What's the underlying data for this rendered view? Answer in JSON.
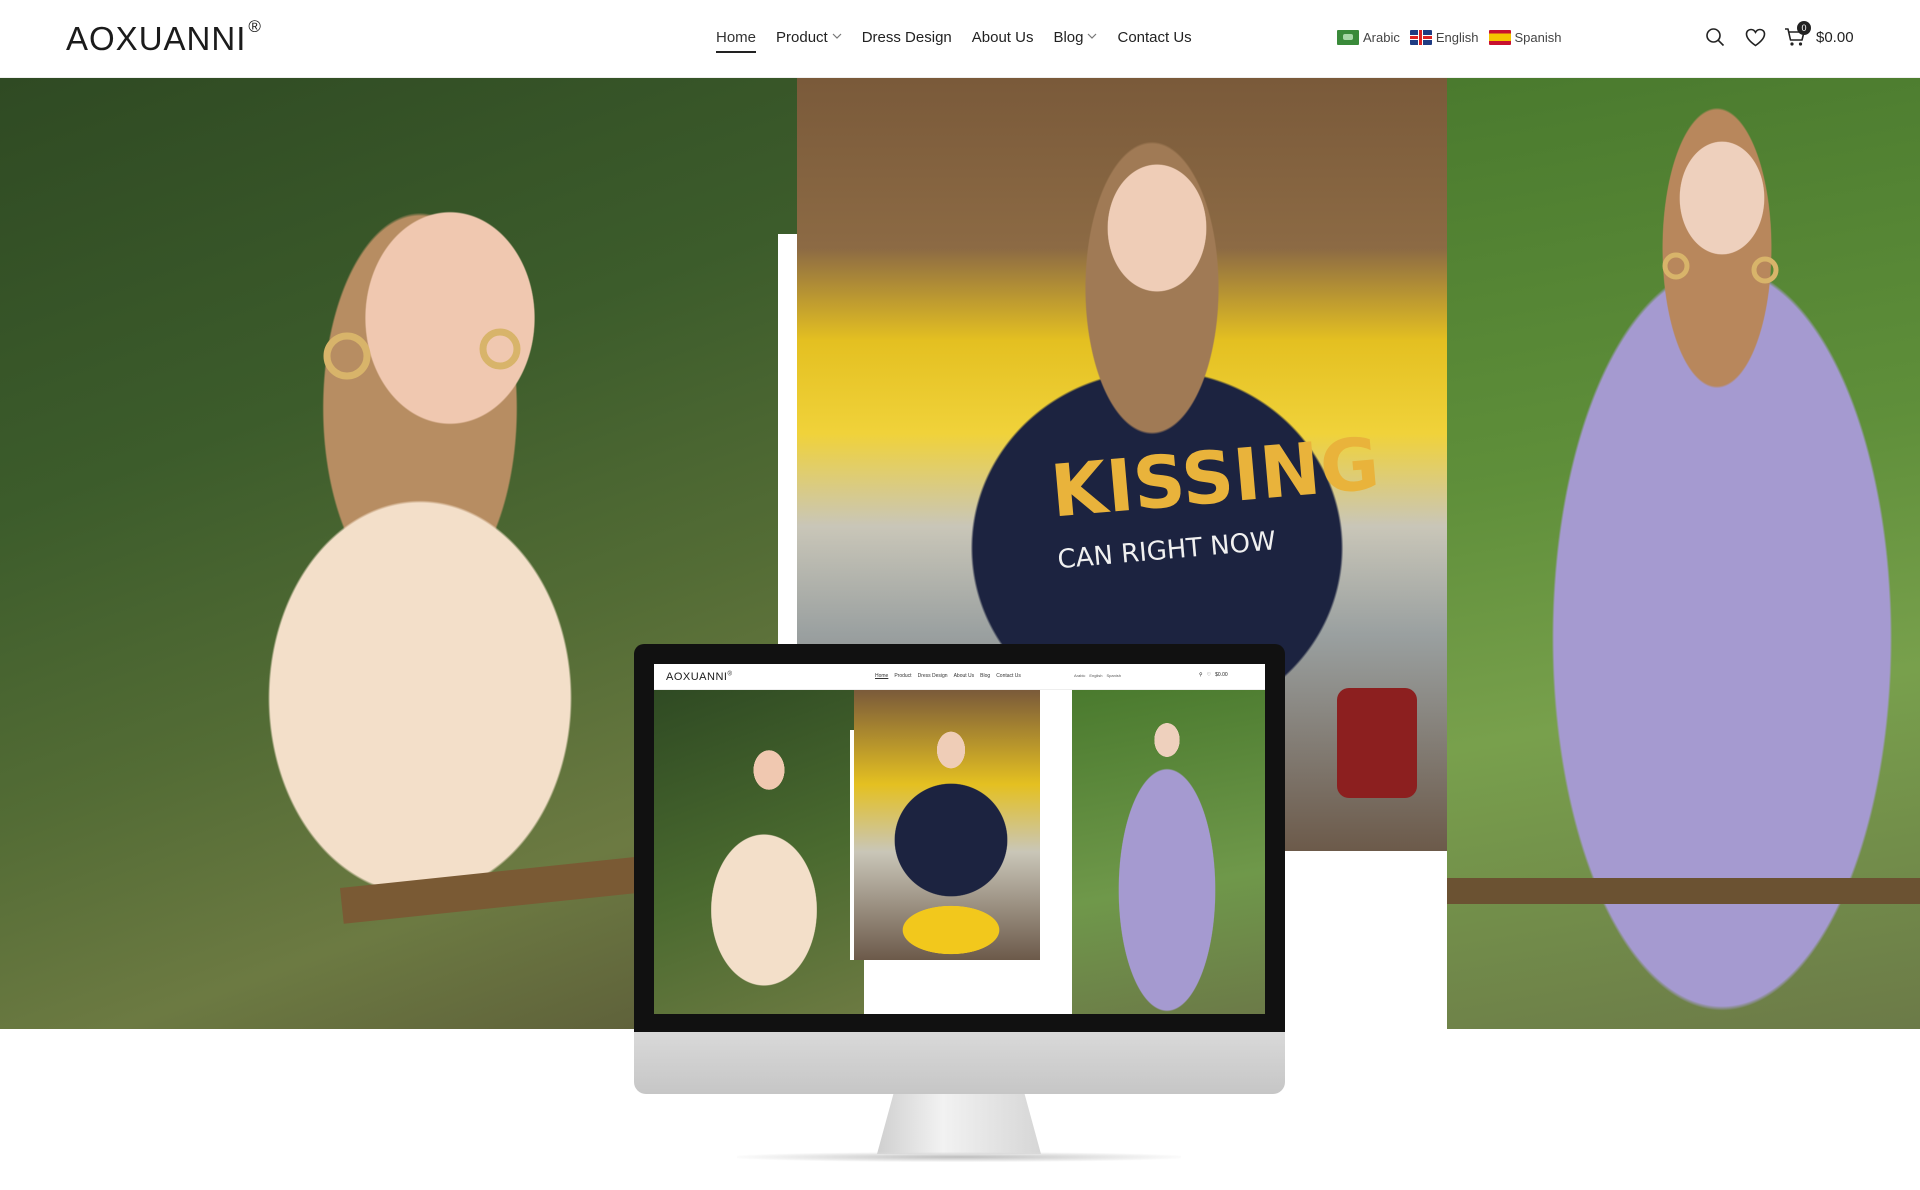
{
  "header": {
    "logo": "AOXUANNI",
    "logo_mark": "®",
    "nav": [
      {
        "label": "Home",
        "active": true,
        "dropdown": false
      },
      {
        "label": "Product",
        "active": false,
        "dropdown": true
      },
      {
        "label": "Dress Design",
        "active": false,
        "dropdown": false
      },
      {
        "label": "About Us",
        "active": false,
        "dropdown": false
      },
      {
        "label": "Blog",
        "active": false,
        "dropdown": true
      },
      {
        "label": "Contact Us",
        "active": false,
        "dropdown": false
      }
    ],
    "languages": [
      {
        "label": "Arabic",
        "flag": "ar"
      },
      {
        "label": "English",
        "flag": "en"
      },
      {
        "label": "Spanish",
        "flag": "es"
      }
    ],
    "tools": {
      "search_icon": "search-icon",
      "wishlist_icon": "heart-icon",
      "cart_icon": "cart-icon",
      "cart_count": "0",
      "cart_total": "$0.00"
    }
  },
  "hero": {
    "shirt_text_line1": "KISSING",
    "shirt_text_line2": "CAN RIGHT NOW"
  },
  "monitor_preview": {
    "logo": "AOXUANNI",
    "logo_mark": "®",
    "nav": [
      "Home",
      "Product",
      "Dress Design",
      "About Us",
      "Blog",
      "Contact Us"
    ],
    "languages": [
      "Arabic",
      "English",
      "Spanish"
    ],
    "cart_total": "$0.00"
  },
  "colors": {
    "text": "#222222",
    "background": "#ffffff",
    "monitor_bezel": "#111111",
    "monitor_chin": "#cfcfcf"
  }
}
